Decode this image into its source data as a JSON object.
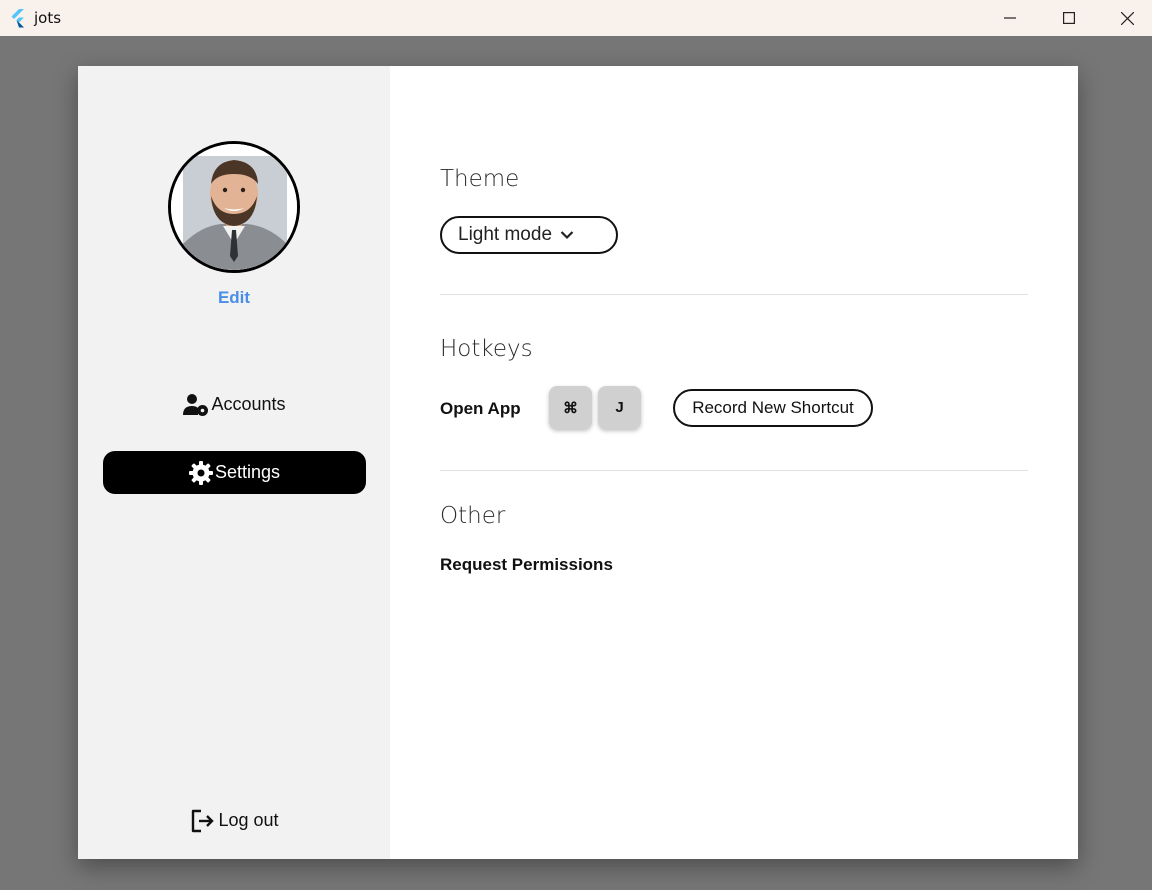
{
  "window": {
    "title": "jots"
  },
  "sidebar": {
    "edit_label": "Edit",
    "nav": [
      {
        "label": "Accounts",
        "icon": "user-gear-icon",
        "active": false
      },
      {
        "label": "Settings",
        "icon": "gear-icon",
        "active": true
      }
    ],
    "logout_label": "Log out"
  },
  "settings": {
    "theme": {
      "title": "Theme",
      "selected": "Light mode"
    },
    "hotkeys": {
      "title": "Hotkeys",
      "open_app_label": "Open App",
      "keys": [
        "⌘",
        "J"
      ],
      "record_label": "Record New Shortcut"
    },
    "other": {
      "title": "Other",
      "request_permissions_label": "Request Permissions"
    }
  },
  "colors": {
    "accent_link": "#4a8ee8",
    "active_nav_bg": "#000000",
    "sidebar_bg": "#f2f2f2"
  }
}
